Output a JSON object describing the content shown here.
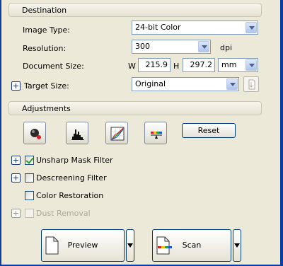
{
  "destination": {
    "header": "Destination",
    "image_type": {
      "label": "Image Type:",
      "value": "24-bit Color"
    },
    "resolution": {
      "label": "Resolution:",
      "value": "300",
      "unit": "dpi"
    },
    "document_size": {
      "label": "Document Size:",
      "w_label": "W",
      "w_value": "215.9",
      "h_label": "H",
      "h_value": "297.2",
      "unit": "mm"
    },
    "target_size": {
      "label": "Target Size:",
      "value": "Original"
    }
  },
  "adjustments": {
    "header": "Adjustments",
    "reset_label": "Reset",
    "tools": [
      "auto-exposure-icon",
      "histogram-icon",
      "tone-curve-icon",
      "color-palette-icon"
    ],
    "options": [
      {
        "label": "Unsharp Mask Filter",
        "checked": true,
        "expandable": true,
        "enabled": true
      },
      {
        "label": "Descreening Filter",
        "checked": false,
        "expandable": true,
        "enabled": true
      },
      {
        "label": "Color Restoration",
        "checked": false,
        "expandable": false,
        "enabled": true
      },
      {
        "label": "Dust Removal",
        "checked": false,
        "expandable": true,
        "enabled": false
      }
    ]
  },
  "footer": {
    "preview_label": "Preview",
    "scan_label": "Scan"
  },
  "colors": {
    "panel": "#ece9d8",
    "frame": "#0a3f9f",
    "input_border": "#7f9db9",
    "check": "#21a121"
  }
}
